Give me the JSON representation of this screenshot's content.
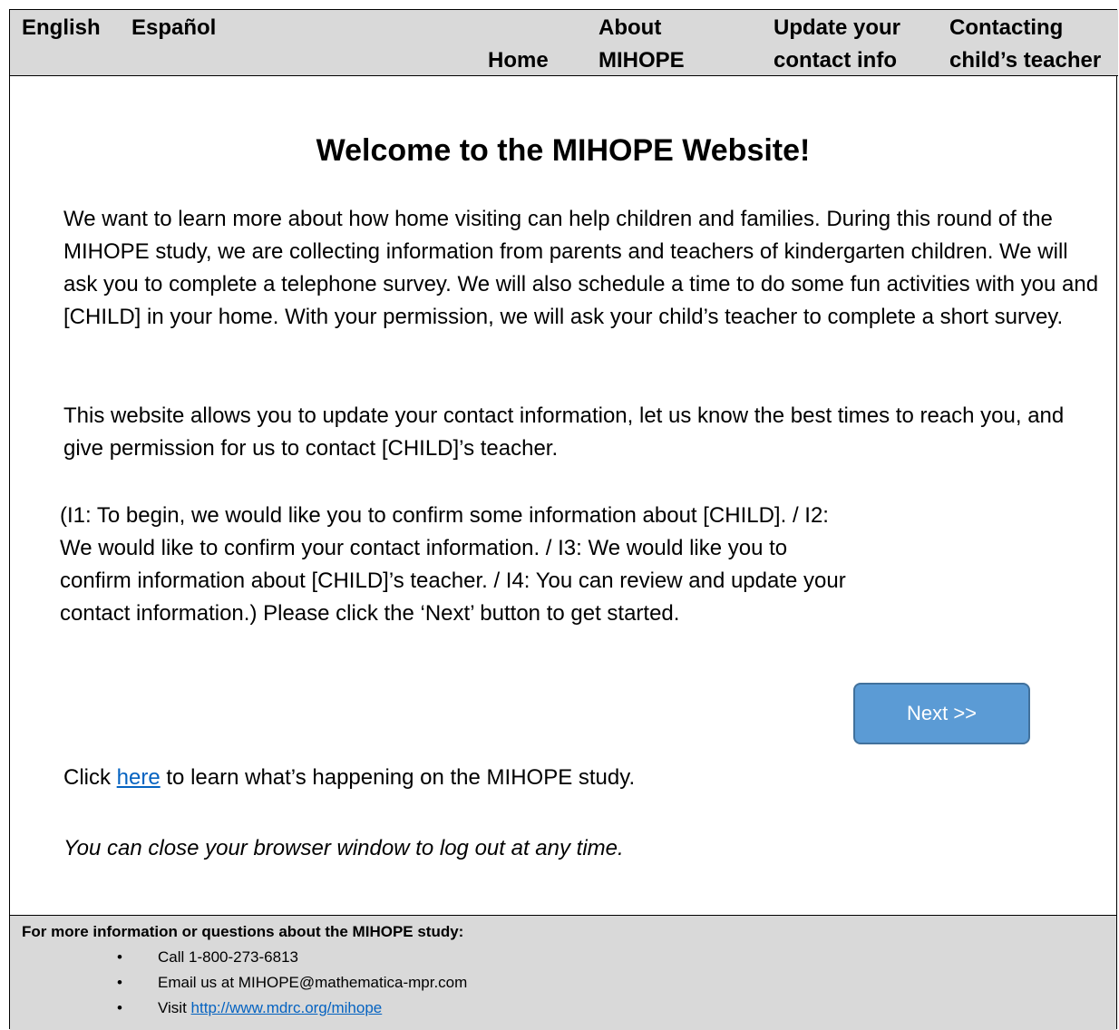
{
  "nav": {
    "lang_english": "English",
    "lang_spanish": "Español",
    "home": "Home",
    "about_line1": "About",
    "about_line2": "MIHOPE",
    "update_line1": "Update your",
    "update_line2": "contact info",
    "contact_line1": "Contacting",
    "contact_line2": "child’s teacher"
  },
  "main": {
    "title": "Welcome to the MIHOPE Website!",
    "intro": "We want to learn more about how home visiting can help children and families. During this round of the MIHOPE study, we are collecting information from parents and teachers of kindergarten children. We will ask you to complete a telephone survey. We will also schedule a time to do some fun activities with you and [CHILD] in your home. With your permission, we will ask your child’s teacher to complete a short survey.",
    "purpose": "This website allows you to update your contact information, let us know the best times to reach you, and give permission for us to contact [CHILD]’s teacher.",
    "instructions": "(I1: To begin, we would like you to confirm some information about [CHILD]. / I2: We would like to confirm your contact information. / I3: We would like you to confirm information about [CHILD]’s teacher. / I4: You can review and update your contact information.) Please click the ‘Next’ button to get started.",
    "next_label": "Next >>",
    "click_prefix": "Click ",
    "here_link": "here",
    "click_suffix": " to learn what’s happening on the MIHOPE study.",
    "logout_note": "You can close your browser window to log out at any time."
  },
  "footer": {
    "title": "For more information or questions about the MIHOPE study:",
    "bullet": "•",
    "call": "Call 1-800-273-6813",
    "email": "Email us at MIHOPE@mathematica-mpr.com",
    "visit_prefix": "Visit ",
    "visit_link": "http://www.mdrc.org/mihope"
  },
  "colors": {
    "nav_bg": "#d9d9d9",
    "button_fill": "#5b9bd5",
    "button_border": "#41719c",
    "link": "#0563c1"
  }
}
